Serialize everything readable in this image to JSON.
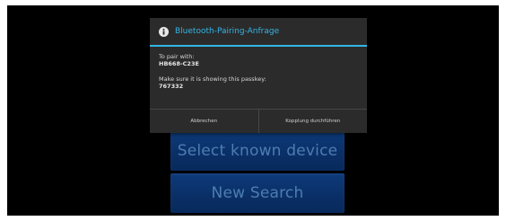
{
  "app": {
    "buttons": {
      "select_known_device": "Select known device",
      "new_search": "New Search"
    }
  },
  "dialog": {
    "icon": "info-icon",
    "title": "Bluetooth-Pairing-Anfrage",
    "pair_label": "To pair with:",
    "device_name": "HB668-C23E",
    "passkey_label": "Make sure it is showing this passkey:",
    "passkey": "767332",
    "cancel_label": "Abbrechen",
    "confirm_label": "Kopplung durchführen"
  },
  "colors": {
    "accent": "#33b5e5",
    "dialog_bg": "#2b2b2b",
    "button_bg": "#0a2f66",
    "button_text": "#4d7db0",
    "screen_bg": "#000000"
  }
}
